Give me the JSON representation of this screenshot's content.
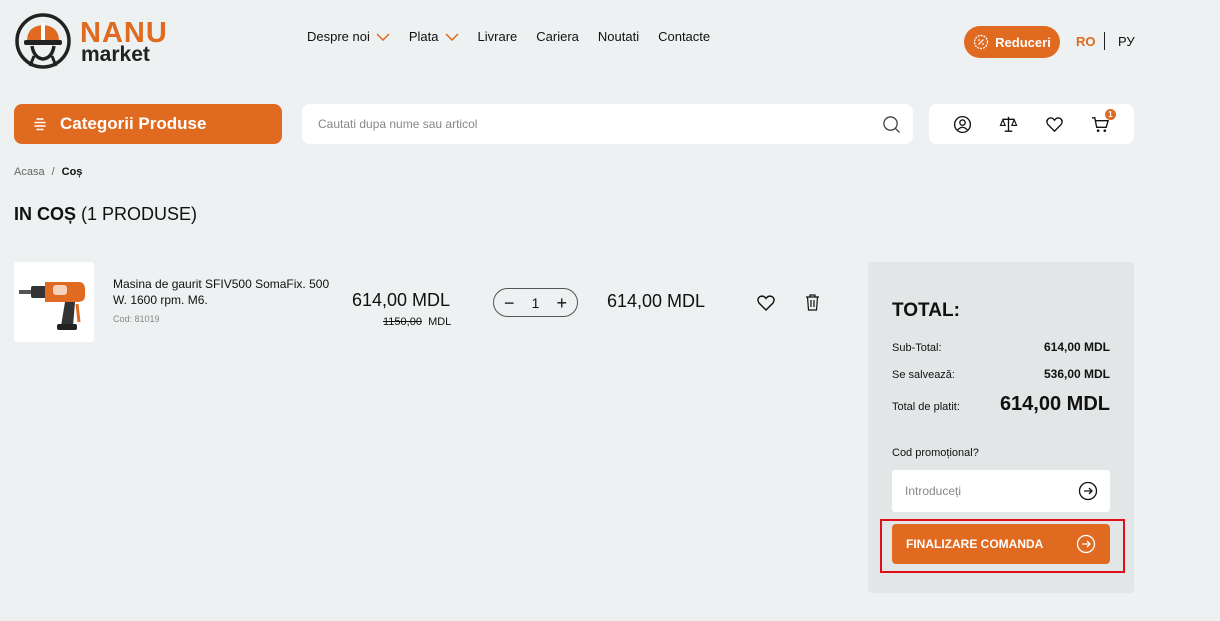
{
  "header": {
    "brand": "NANU",
    "brand_sub": "market",
    "nav": [
      {
        "label": "Despre noi",
        "dropdown": true
      },
      {
        "label": "Plata",
        "dropdown": true
      },
      {
        "label": "Livrare",
        "dropdown": false
      },
      {
        "label": "Cariera",
        "dropdown": false
      },
      {
        "label": "Noutati",
        "dropdown": false
      },
      {
        "label": "Contacte",
        "dropdown": false
      }
    ],
    "reduceri_label": "Reduceri",
    "lang_active": "RO",
    "lang_other": "РУ"
  },
  "toolbar": {
    "categories_label": "Categorii Produse",
    "search_placeholder": "Cautati dupa nume sau articol",
    "cart_count": "1",
    "icons": [
      "user-icon",
      "compare-scale-icon",
      "heart-icon",
      "cart-icon"
    ]
  },
  "breadcrumb": {
    "home": "Acasa",
    "separator": "/",
    "current": "Coș"
  },
  "page": {
    "title_bold": "IN COȘ",
    "title_count": "(1 PRODUSE)"
  },
  "cart": {
    "item": {
      "name": "Masina de gaurit SFIV500 SomaFix. 500 W. 1600 rpm. M6.",
      "code": "Cod: 81019",
      "price": "614,00  MDL",
      "old_price": "1150,00",
      "old_currency": "MDL",
      "quantity": "1",
      "line_total": "614,00  MDL"
    }
  },
  "summary": {
    "title": "TOTAL:",
    "subtotal_label": "Sub-Total:",
    "subtotal_value": "614,00  MDL",
    "saved_label": "Se salvează:",
    "saved_value": "536,00  MDL",
    "total_label": "Total de platit:",
    "total_value": "614,00 MDL",
    "promo_label": "Cod promoțional?",
    "promo_placeholder": "Introduceți",
    "checkout_label": "FINALIZARE COMANDA"
  },
  "colors": {
    "accent": "#e06a1f",
    "highlight": "#e0101a",
    "background": "#eef1f1"
  }
}
